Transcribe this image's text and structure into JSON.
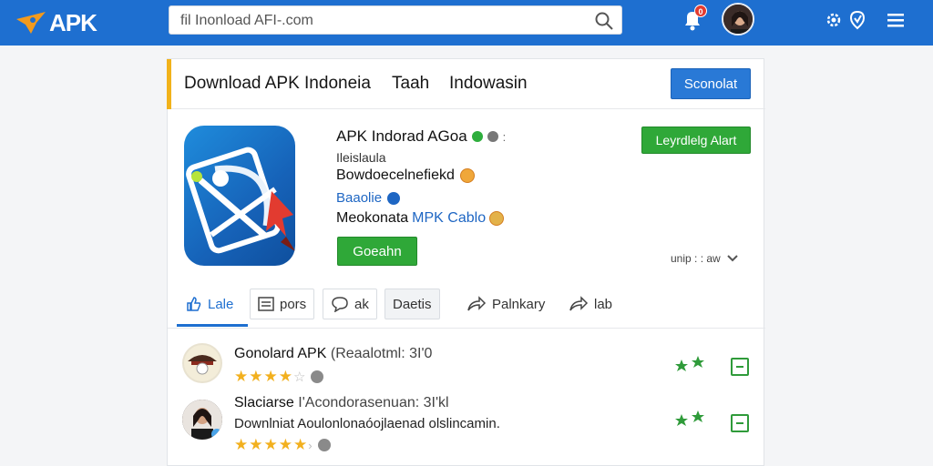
{
  "header": {
    "logo_text": "APK",
    "search_value": "ﬁl Inonload AFI-.com",
    "notification_count": "0"
  },
  "card": {
    "title": "Download APK Indoneia",
    "link_1": "Taah",
    "link_2": "Indowasin",
    "primary_button": "Sconolat"
  },
  "app": {
    "name": "APK Indorad AGoa",
    "meta_1": "Ileislaula",
    "meta_2": "Bowdoecelnefiekd",
    "meta_3": "Baaolie",
    "meta_4_prefix": "Meokonata",
    "meta_4_highlight": "MPK Cablo",
    "install_button": "Goeahn",
    "download_button": "Leyrdlelg Alart",
    "more_label": "unip : : aw"
  },
  "tabs": [
    {
      "label": "Lale",
      "icon": "thumbs-up-icon"
    },
    {
      "label": "pors",
      "icon": "list-icon"
    },
    {
      "label": "ak",
      "icon": "chat-icon"
    },
    {
      "label": "Daetis",
      "icon": ""
    },
    {
      "label": "Palnkary",
      "icon": "share-icon"
    },
    {
      "label": "lab",
      "icon": "share-icon"
    }
  ],
  "reviews": [
    {
      "title": "Gonolard APK",
      "meta": "(Reaalotml: 3I'0",
      "body": "",
      "rating": 4.5
    },
    {
      "title": "Slaciarse",
      "meta": "I'Acondorasenuan: 3I'kl",
      "body": "Downlniat Aoulonlonaóojlaenad olslincamin.",
      "rating": 5
    }
  ],
  "colors": {
    "topbar": "#1e6fd0",
    "accent": "#f1b21b",
    "green": "#2fa838",
    "blue_button": "#2979d6"
  }
}
